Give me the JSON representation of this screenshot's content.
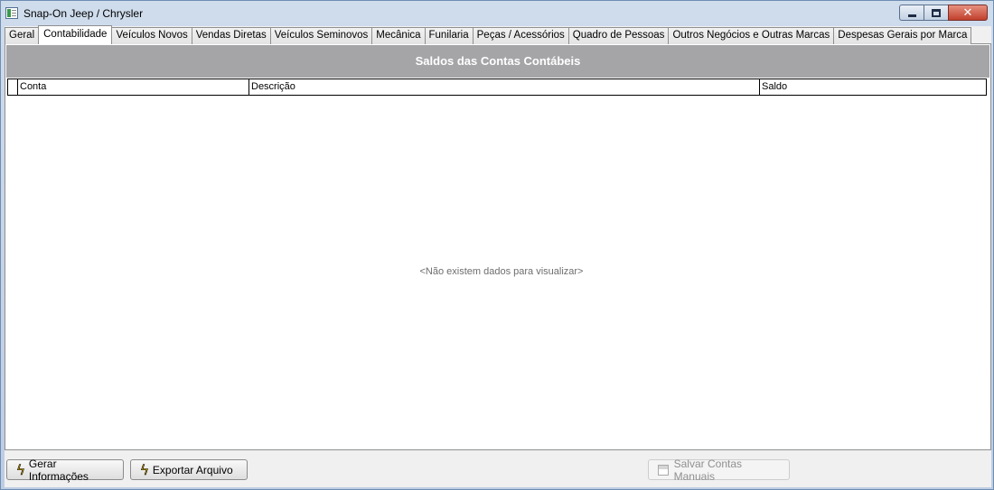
{
  "window": {
    "title": "Snap-On Jeep / Chrysler",
    "controls": {
      "minimize": "minimize",
      "maximize": "maximize",
      "close": "✕"
    }
  },
  "tabs": [
    {
      "label": "Geral",
      "active": false
    },
    {
      "label": "Contabilidade",
      "active": true
    },
    {
      "label": "Veículos Novos",
      "active": false
    },
    {
      "label": "Vendas Diretas",
      "active": false
    },
    {
      "label": "Veículos Seminovos",
      "active": false
    },
    {
      "label": "Mecânica",
      "active": false
    },
    {
      "label": "Funilaria",
      "active": false
    },
    {
      "label": "Peças / Acessórios",
      "active": false
    },
    {
      "label": "Quadro de Pessoas",
      "active": false
    },
    {
      "label": "Outros Negócios e Outras Marcas",
      "active": false
    },
    {
      "label": "Despesas Gerais por Marca",
      "active": false
    }
  ],
  "grid": {
    "title": "Saldos das Contas Contábeis",
    "columns": {
      "conta": "Conta",
      "descricao": "Descrição",
      "saldo": "Saldo"
    },
    "empty_message": "<Não existem dados para visualizar>"
  },
  "buttons": {
    "gerar": {
      "label": "Gerar Informações",
      "icon": "lightning-icon"
    },
    "exportar": {
      "label": "Exportar Arquivo",
      "icon": "lightning-icon"
    },
    "salvar": {
      "label": "Salvar Contas Manuais",
      "icon": "save-disk-icon",
      "enabled": false
    }
  },
  "colors": {
    "grid_title_bg": "#a5a5a8",
    "close_button": "#c0402c",
    "lightning": "#e3b300"
  }
}
